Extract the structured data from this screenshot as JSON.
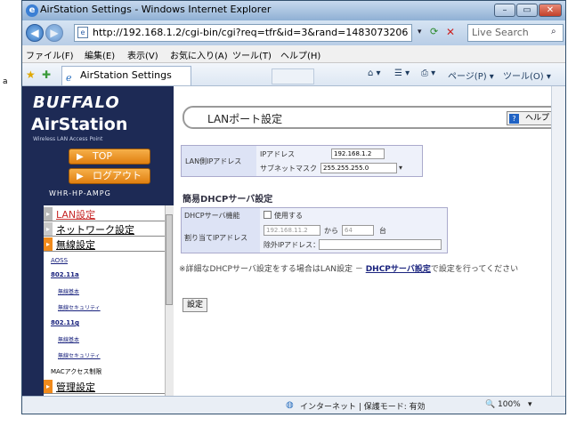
{
  "window": {
    "title": "AirStation Settings - Windows Internet Explorer"
  },
  "address": {
    "url": "http://192.168.1.2/cgi-bin/cgi?req=tfr&id=3&rand=1483073206",
    "search_placeholder": "Live Search"
  },
  "menubar": {
    "items": [
      "ファイル(F)",
      "編集(E)",
      "表示(V)",
      "お気に入り(A)",
      "ツール(T)",
      "ヘルプ(H)"
    ]
  },
  "tab": {
    "label": "AirStation Settings"
  },
  "toolbar": {
    "page_label": "ページ(P) ▾",
    "tools_label": "ツール(O) ▾"
  },
  "sidebar": {
    "brand": "BUFFALO",
    "product": "AirStation",
    "tagline": "Wireless LAN Access Point",
    "top_button": "TOP",
    "logout_button": "ログアウト",
    "model": "WHR-HP-AMPG",
    "menu": [
      {
        "type": "section",
        "label": "LAN設定",
        "active": true
      },
      {
        "type": "section",
        "label": "ネットワーク設定",
        "active": false
      },
      {
        "type": "section",
        "label": "無線設定",
        "active": true
      },
      {
        "type": "sub",
        "label": "AOSS"
      },
      {
        "type": "sub",
        "label": "802.11a"
      },
      {
        "type": "sub2",
        "label": "無線基本"
      },
      {
        "type": "sub2",
        "label": "無線セキュリティ"
      },
      {
        "type": "sub",
        "label": "802.11g"
      },
      {
        "type": "sub2",
        "label": "無線基本"
      },
      {
        "type": "sub2",
        "label": "無線セキュリティ"
      },
      {
        "type": "sub",
        "label": "MACアクセス制限"
      },
      {
        "type": "section",
        "label": "管理設定",
        "active": true
      }
    ]
  },
  "main": {
    "heading": "LANポート設定",
    "help_label": "ヘルプ",
    "lan": {
      "row_label": "LAN側IPアドレス",
      "ip_label": "IPアドレス",
      "ip_value": "192.168.1.2",
      "mask_label": "サブネットマスク",
      "mask_value": "255.255.255.0"
    },
    "dhcp": {
      "title": "簡易DHCPサーバ設定",
      "function_label": "DHCPサーバ機能",
      "use_label": "使用する",
      "use_checked": false,
      "range_label": "割り当てIPアドレス",
      "range_start": "192.168.11.2",
      "range_from": "から",
      "range_count": "64",
      "range_unit": "台",
      "exclude_label": "除外IPアドレス："
    },
    "note_prefix": "※詳細なDHCPサーバ設定をする場合はLAN設定 － ",
    "note_link": "DHCPサーバ設定",
    "note_suffix": "で設定を行ってください",
    "set_button": "設定"
  },
  "statusbar": {
    "zone": "インターネット | 保護モード: 有効",
    "zoom": "100%"
  },
  "side_marker": "a"
}
